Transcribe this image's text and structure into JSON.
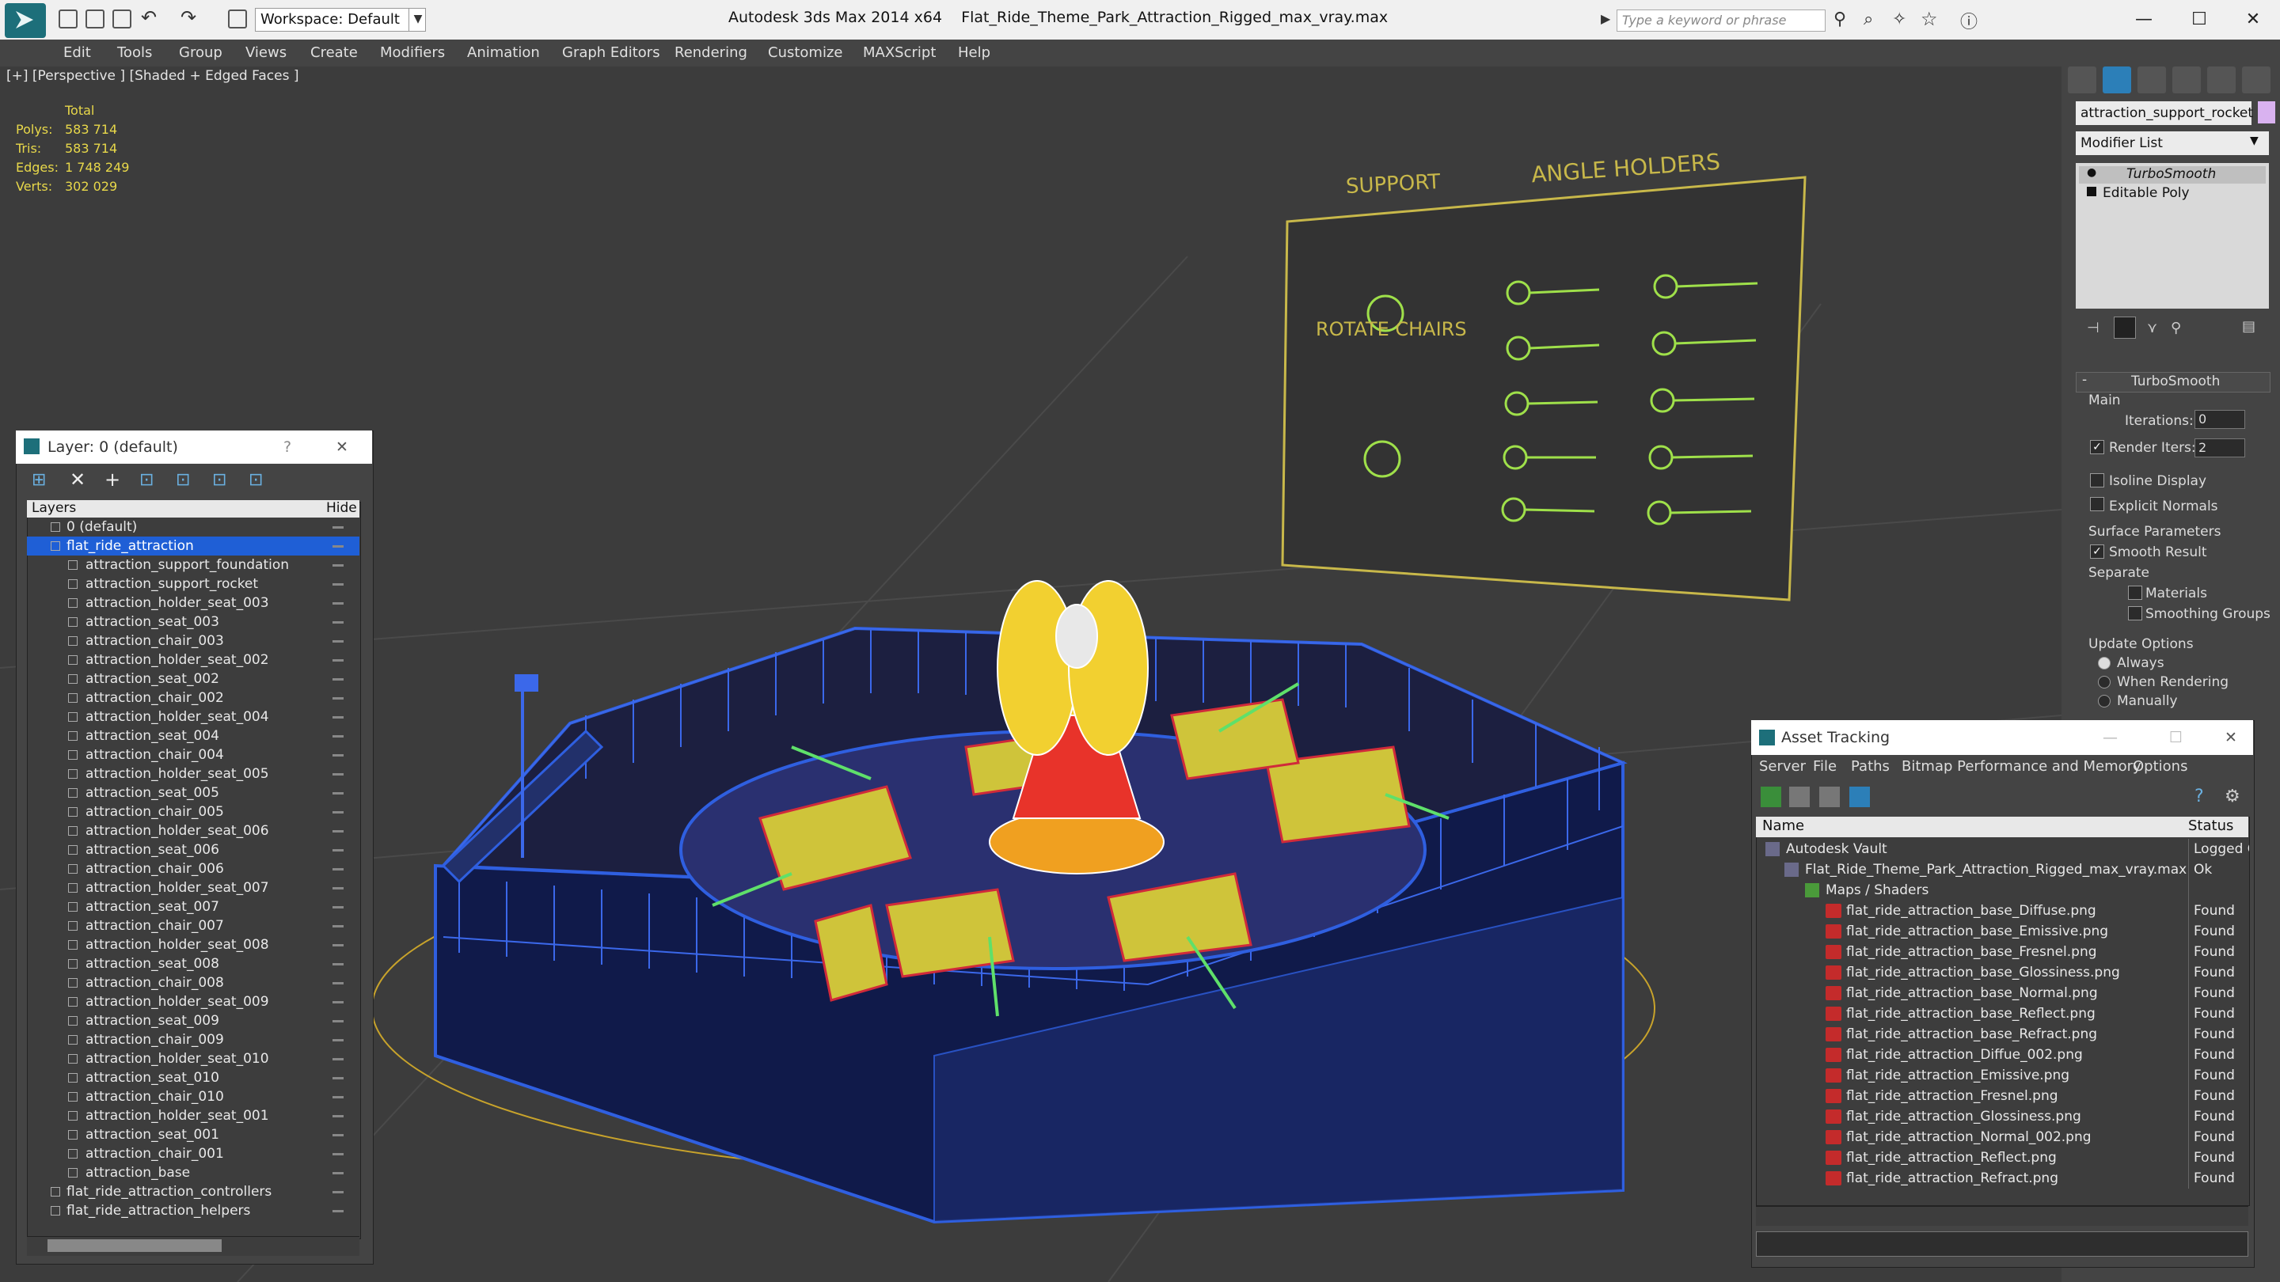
{
  "app": {
    "title": "Autodesk 3ds Max  2014 x64",
    "file": "Flat_Ride_Theme_Park_Attraction_Rigged_max_vray.max",
    "workspace": "Workspace: Default",
    "search_placeholder": "Type a keyword or phrase"
  },
  "menu": [
    "Edit",
    "Tools",
    "Group",
    "Views",
    "Create",
    "Modifiers",
    "Animation",
    "Graph Editors",
    "Rendering",
    "Customize",
    "MAXScript",
    "Help"
  ],
  "viewport": {
    "label": "[+] [Perspective ] [Shaded + Edged Faces ]",
    "stats": {
      "header": "Total",
      "rows": [
        {
          "k": "Polys:",
          "v": "583 714"
        },
        {
          "k": "Tris:",
          "v": "583 714"
        },
        {
          "k": "Edges:",
          "v": "1 748 249"
        },
        {
          "k": "Verts:",
          "v": "302 029"
        }
      ]
    },
    "board": {
      "support": "SUPPORT",
      "angle_holders": "ANGLE HOLDERS",
      "rotate_chairs": "ROTATE CHAIRS"
    }
  },
  "command_panel": {
    "object_name": "attraction_support_rocket",
    "modifier_list": "Modifier List",
    "stack": [
      "TurboSmooth",
      "Editable Poly"
    ],
    "rollout_title": "TurboSmooth",
    "main": "Main",
    "iterations_label": "Iterations:",
    "iterations": "0",
    "render_iters_label": "Render Iters:",
    "render_iters": "2",
    "isoline": "Isoline Display",
    "explicit_normals": "Explicit Normals",
    "surface_params": "Surface Parameters",
    "smooth_result": "Smooth Result",
    "separate": "Separate",
    "materials": "Materials",
    "smoothing_groups": "Smoothing Groups",
    "update_options": "Update Options",
    "always": "Always",
    "when_rendering": "When Rendering",
    "manually": "Manually"
  },
  "layer_window": {
    "title": "Layer: 0 (default)",
    "help": "?",
    "col_layers": "Layers",
    "col_hide": "Hide",
    "rows": [
      {
        "name": "0 (default)",
        "level": 0,
        "type": "layer"
      },
      {
        "name": "flat_ride_attraction",
        "level": 0,
        "type": "layer",
        "selected": true
      },
      {
        "name": "attraction_support_foundation",
        "level": 1
      },
      {
        "name": "attraction_support_rocket",
        "level": 1
      },
      {
        "name": "attraction_holder_seat_003",
        "level": 1
      },
      {
        "name": "attraction_seat_003",
        "level": 1
      },
      {
        "name": "attraction_chair_003",
        "level": 1
      },
      {
        "name": "attraction_holder_seat_002",
        "level": 1
      },
      {
        "name": "attraction_seat_002",
        "level": 1
      },
      {
        "name": "attraction_chair_002",
        "level": 1
      },
      {
        "name": "attraction_holder_seat_004",
        "level": 1
      },
      {
        "name": "attraction_seat_004",
        "level": 1
      },
      {
        "name": "attraction_chair_004",
        "level": 1
      },
      {
        "name": "attraction_holder_seat_005",
        "level": 1
      },
      {
        "name": "attraction_seat_005",
        "level": 1
      },
      {
        "name": "attraction_chair_005",
        "level": 1
      },
      {
        "name": "attraction_holder_seat_006",
        "level": 1
      },
      {
        "name": "attraction_seat_006",
        "level": 1
      },
      {
        "name": "attraction_chair_006",
        "level": 1
      },
      {
        "name": "attraction_holder_seat_007",
        "level": 1
      },
      {
        "name": "attraction_seat_007",
        "level": 1
      },
      {
        "name": "attraction_chair_007",
        "level": 1
      },
      {
        "name": "attraction_holder_seat_008",
        "level": 1
      },
      {
        "name": "attraction_seat_008",
        "level": 1
      },
      {
        "name": "attraction_chair_008",
        "level": 1
      },
      {
        "name": "attraction_holder_seat_009",
        "level": 1
      },
      {
        "name": "attraction_seat_009",
        "level": 1
      },
      {
        "name": "attraction_chair_009",
        "level": 1
      },
      {
        "name": "attraction_holder_seat_010",
        "level": 1
      },
      {
        "name": "attraction_seat_010",
        "level": 1
      },
      {
        "name": "attraction_chair_010",
        "level": 1
      },
      {
        "name": "attraction_holder_seat_001",
        "level": 1
      },
      {
        "name": "attraction_seat_001",
        "level": 1
      },
      {
        "name": "attraction_chair_001",
        "level": 1
      },
      {
        "name": "attraction_base",
        "level": 1
      },
      {
        "name": "flat_ride_attraction_controllers",
        "level": 0,
        "type": "layer"
      },
      {
        "name": "flat_ride_attraction_helpers",
        "level": 0,
        "type": "layer"
      }
    ]
  },
  "asset_tracking": {
    "title": "Asset Tracking",
    "menu": [
      "Server",
      "File",
      "Paths",
      "Bitmap Performance and Memory",
      "Options"
    ],
    "col_name": "Name",
    "col_status": "Status",
    "rows": [
      {
        "name": "Autodesk Vault",
        "status": "Logged O",
        "level": 0
      },
      {
        "name": "Flat_Ride_Theme_Park_Attraction_Rigged_max_vray.max",
        "status": "Ok",
        "level": 1
      },
      {
        "name": "Maps / Shaders",
        "status": "",
        "level": 2
      },
      {
        "name": "flat_ride_attraction_base_Diffuse.png",
        "status": "Found",
        "level": 3
      },
      {
        "name": "flat_ride_attraction_base_Emissive.png",
        "status": "Found",
        "level": 3
      },
      {
        "name": "flat_ride_attraction_base_Fresnel.png",
        "status": "Found",
        "level": 3
      },
      {
        "name": "flat_ride_attraction_base_Glossiness.png",
        "status": "Found",
        "level": 3
      },
      {
        "name": "flat_ride_attraction_base_Normal.png",
        "status": "Found",
        "level": 3
      },
      {
        "name": "flat_ride_attraction_base_Reflect.png",
        "status": "Found",
        "level": 3
      },
      {
        "name": "flat_ride_attraction_base_Refract.png",
        "status": "Found",
        "level": 3
      },
      {
        "name": "flat_ride_attraction_Diffue_002.png",
        "status": "Found",
        "level": 3
      },
      {
        "name": "flat_ride_attraction_Emissive.png",
        "status": "Found",
        "level": 3
      },
      {
        "name": "flat_ride_attraction_Fresnel.png",
        "status": "Found",
        "level": 3
      },
      {
        "name": "flat_ride_attraction_Glossiness.png",
        "status": "Found",
        "level": 3
      },
      {
        "name": "flat_ride_attraction_Normal_002.png",
        "status": "Found",
        "level": 3
      },
      {
        "name": "flat_ride_attraction_Reflect.png",
        "status": "Found",
        "level": 3
      },
      {
        "name": "flat_ride_attraction_Refract.png",
        "status": "Found",
        "level": 3
      }
    ]
  },
  "colors": {
    "wire_blue": "#2f5fe0",
    "selection": "#1f5fd6",
    "stats_yellow": "#e8d84a",
    "board_green": "#9fe04a"
  }
}
